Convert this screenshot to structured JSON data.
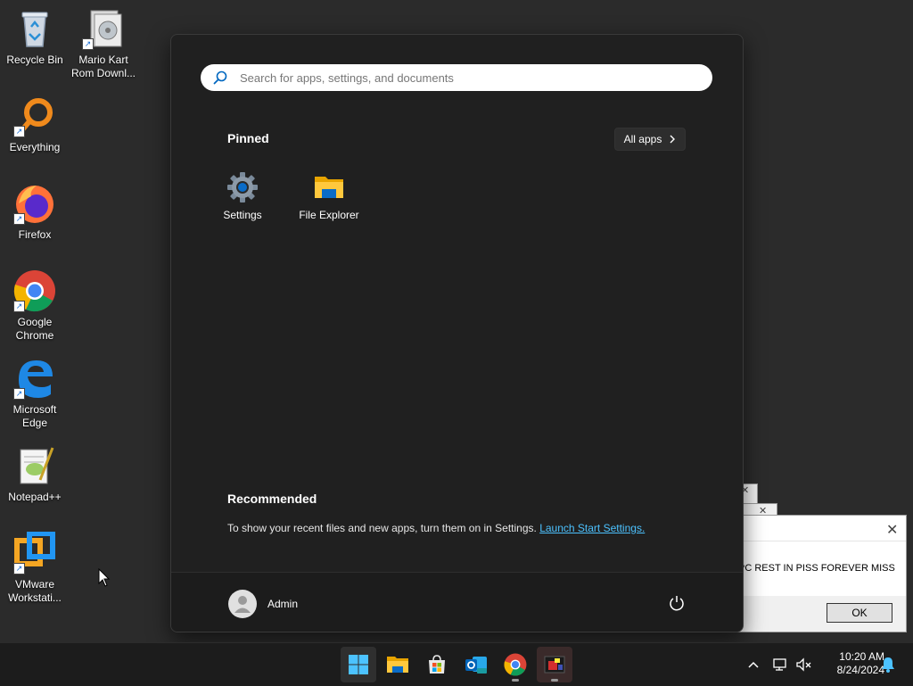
{
  "desktop": {
    "icons": [
      {
        "label": "Recycle Bin"
      },
      {
        "label": "Mario Kart Rom Downl..."
      },
      {
        "label": "Everything"
      },
      {
        "label": "Firefox"
      },
      {
        "label": "Google Chrome"
      },
      {
        "label": "Microsoft Edge"
      },
      {
        "label": "Notepad++"
      },
      {
        "label": "VMware Workstati..."
      }
    ]
  },
  "dialog": {
    "message": "PC REST IN PISS FOREVER MISS",
    "ok_label": "OK",
    "close_glyph": "✕"
  },
  "start_menu": {
    "search_placeholder": "Search for apps, settings, and documents",
    "pinned_title": "Pinned",
    "all_apps_label": "All apps",
    "pinned_apps": [
      {
        "label": "Settings",
        "icon": "gear-icon"
      },
      {
        "label": "File Explorer",
        "icon": "folder-icon"
      }
    ],
    "recommended_title": "Recommended",
    "recommended_text": "To show your recent files and new apps, turn them on in Settings.",
    "recommended_link": "Launch Start Settings.",
    "user_name": "Admin"
  },
  "taskbar": {
    "apps": [
      "start-icon",
      "file-explorer-icon",
      "microsoft-store-icon",
      "outlook-icon",
      "chrome-icon",
      "malware-app-icon"
    ],
    "time": "10:20 AM",
    "date": "8/24/2024"
  },
  "colors": {
    "accent": "#4cc2ff",
    "menu_bg": "#202020",
    "taskbar_bg": "#1c1c1c"
  }
}
